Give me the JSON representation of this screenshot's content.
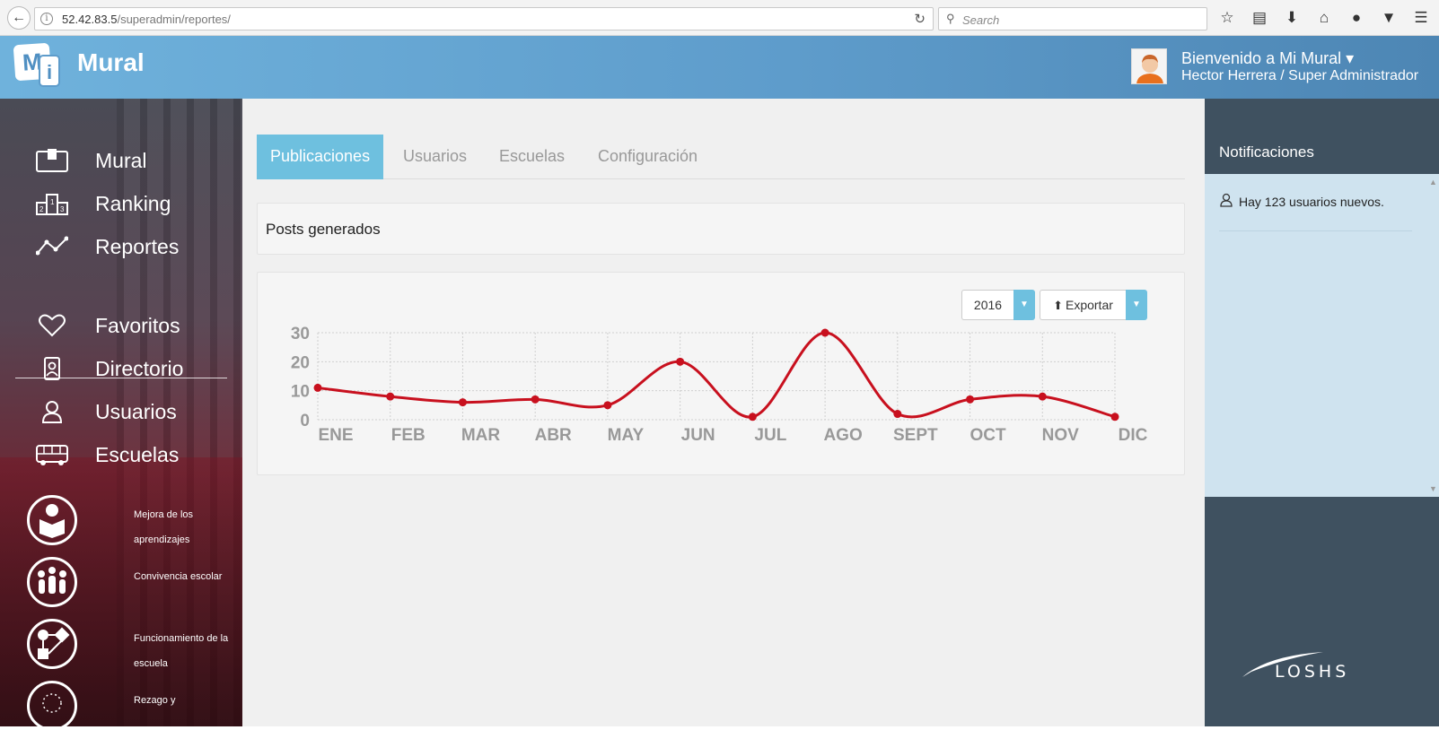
{
  "browser": {
    "url_host": "52.42.83.5",
    "url_path": "/superadmin/reportes/",
    "search_placeholder": "Search"
  },
  "header": {
    "logo_m": "M",
    "logo_i": "i",
    "logo_text": "Mural",
    "welcome": "Bienvenido a Mi Mural ▾",
    "user_line": "Hector Herrera / Super Administrador"
  },
  "sidebar": {
    "items": [
      {
        "label": "Mural",
        "icon": "clipboard-icon"
      },
      {
        "label": "Ranking",
        "icon": "podium-icon"
      },
      {
        "label": "Reportes",
        "icon": "line-chart-icon"
      },
      {
        "label": "Favoritos",
        "icon": "heart-icon"
      },
      {
        "label": "Directorio",
        "icon": "contact-card-icon"
      },
      {
        "label": "Usuarios",
        "icon": "user-icon"
      },
      {
        "label": "Escuelas",
        "icon": "bus-icon"
      }
    ],
    "programs": [
      {
        "label": "Mejora de los aprendizajes",
        "icon": "reading-icon"
      },
      {
        "label": "Convivencia escolar",
        "icon": "people-icon"
      },
      {
        "label": "Funcionamiento de la escuela",
        "icon": "flowchart-icon"
      },
      {
        "label": "Rezago y",
        "icon": "dotted-circle-icon"
      }
    ]
  },
  "main": {
    "tabs": [
      {
        "label": "Publicaciones",
        "active": true
      },
      {
        "label": "Usuarios",
        "active": false
      },
      {
        "label": "Escuelas",
        "active": false
      },
      {
        "label": "Configuración",
        "active": false
      }
    ],
    "panel_title": "Posts generados",
    "year_select": "2016",
    "export_label": "Exportar"
  },
  "chart_data": {
    "type": "line",
    "title": "",
    "xlabel": "",
    "ylabel": "",
    "categories": [
      "ENE",
      "FEB",
      "MAR",
      "ABR",
      "MAY",
      "JUN",
      "JUL",
      "AGO",
      "SEPT",
      "OCT",
      "NOV",
      "DIC"
    ],
    "series": [
      {
        "values": [
          11,
          8,
          6,
          7,
          5,
          20,
          1,
          30,
          2,
          7,
          8,
          1
        ]
      }
    ],
    "yticks": [
      0,
      10,
      20,
      30
    ],
    "ylim": [
      0,
      30
    ],
    "grid": true,
    "line_color": "#c8101e"
  },
  "notifications": {
    "title": "Notificaciones",
    "items": [
      {
        "text": "Hay 123 usuarios nuevos.",
        "icon": "user-icon"
      }
    ]
  },
  "brand": {
    "text": "LOSHS"
  }
}
